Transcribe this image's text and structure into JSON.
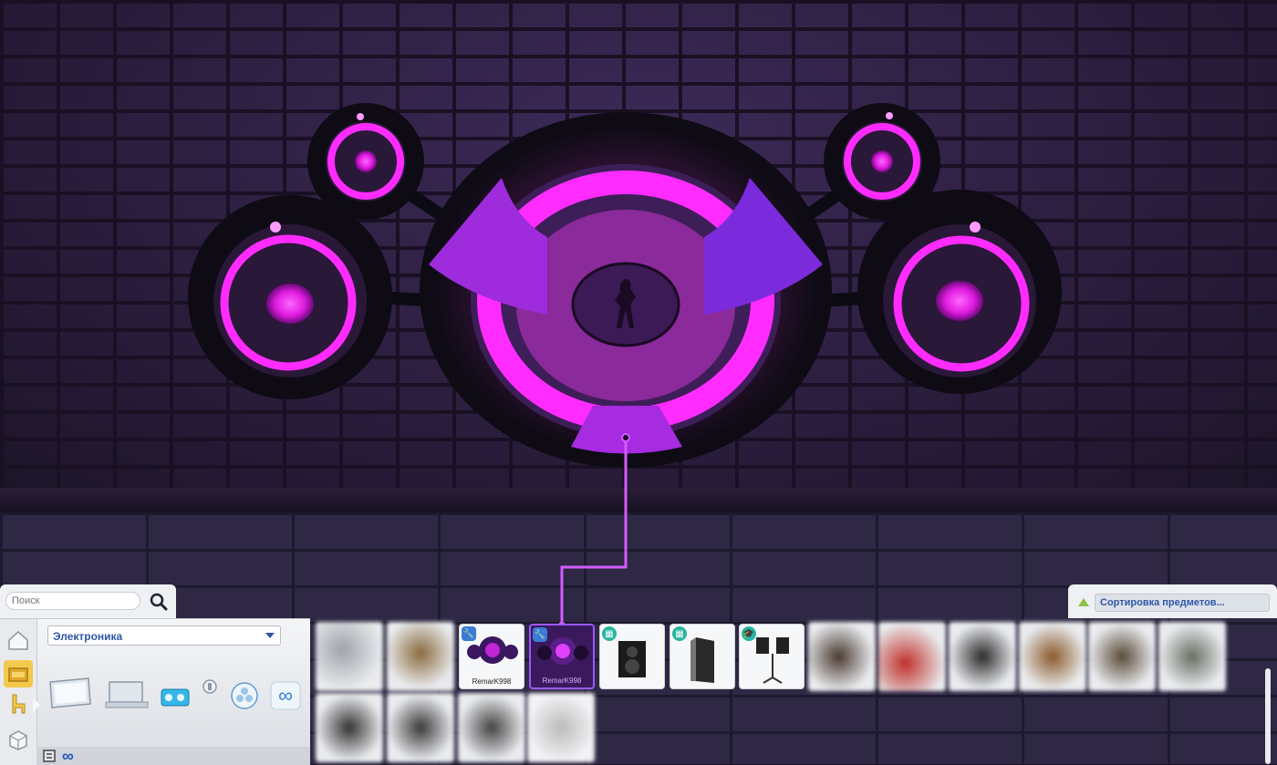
{
  "search": {
    "placeholder": "Поиск"
  },
  "category": {
    "selected": "Электроника"
  },
  "sort": {
    "label": "Сортировка предметов..."
  },
  "panel": {
    "infinity": "∞"
  },
  "items": [
    {
      "label": "RemarK998",
      "badge": "wrench"
    },
    {
      "label": "RemarK998",
      "badge": "wrench",
      "selected": true
    },
    {
      "label": "",
      "badge": "money"
    },
    {
      "label": "",
      "badge": "money"
    },
    {
      "label": "",
      "badge": "graduation"
    }
  ],
  "colors": {
    "accent": "#2f57a8",
    "neon": "#ff2bff",
    "selected_tile": "#3a1a5c"
  }
}
